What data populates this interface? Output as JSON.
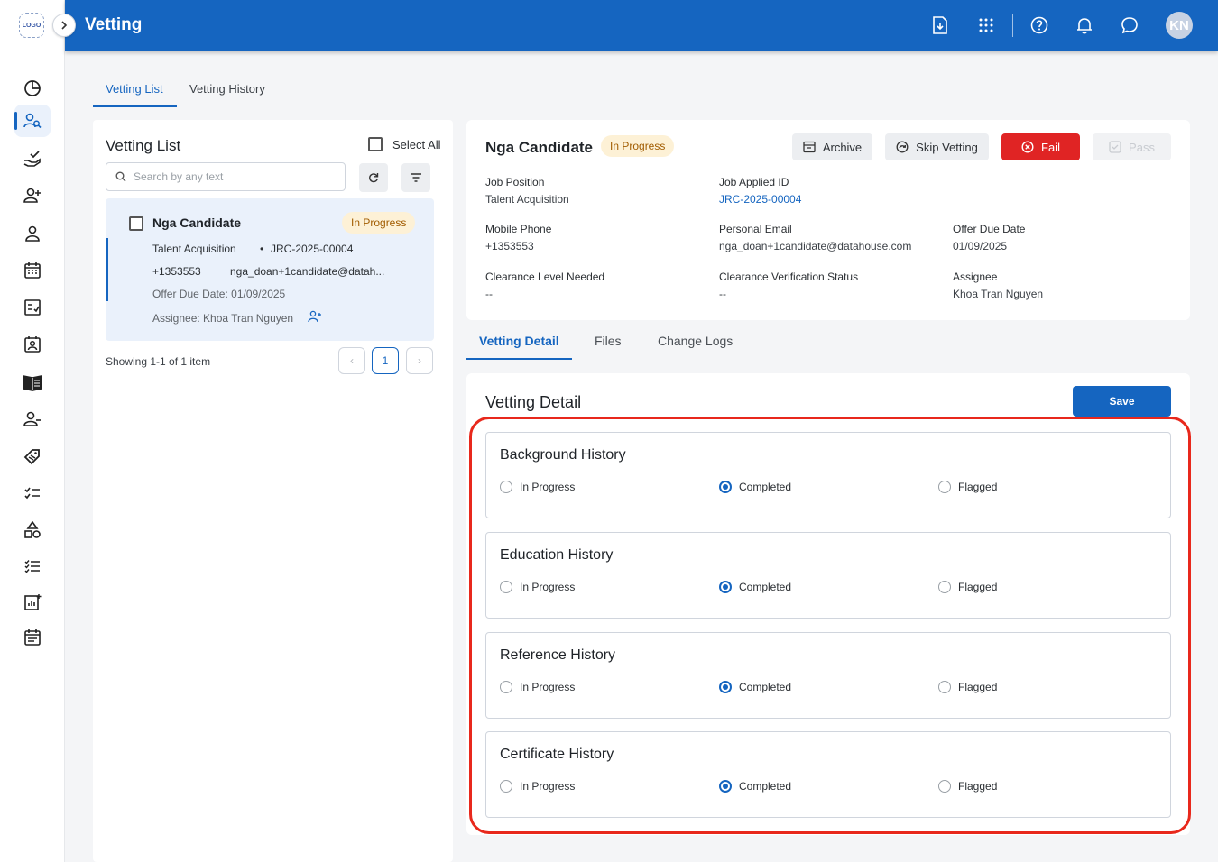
{
  "app": {
    "logo_text": "LOGO",
    "title": "Vetting",
    "avatar_initials": "KN",
    "accent_color": "#1565c0"
  },
  "sidebar": {
    "icons": [
      "dashboard-icon",
      "vetting-icon",
      "hand-check-icon",
      "add-user-icon",
      "user-icon",
      "calendar-icon",
      "checklist-icon",
      "contact-card-icon",
      "book-icon",
      "remove-user-icon",
      "tag-icon",
      "task-list-icon",
      "shapes-icon",
      "list-icon",
      "report-icon",
      "schedule-icon"
    ]
  },
  "header_icons": [
    "download-icon",
    "apps-grid-icon",
    "help-icon",
    "bell-icon",
    "chat-icon"
  ],
  "top_tabs": [
    {
      "label": "Vetting List",
      "active": true
    },
    {
      "label": "Vetting History",
      "active": false
    }
  ],
  "vetting_list": {
    "title": "Vetting List",
    "select_all": "Select All",
    "search_placeholder": "Search by any text",
    "candidate": {
      "name": "Nga Candidate",
      "status": "In Progress",
      "position": "Talent Acquisition",
      "separator": "•",
      "job_id": "JRC-2025-00004",
      "phone": "+1353553",
      "email": "nga_doan+1candidate@datah...",
      "offer_due": "Offer Due Date: 01/09/2025",
      "assignee": "Assignee: Khoa Tran Nguyen"
    },
    "pagination": {
      "summary": "Showing 1-1 of 1 item",
      "prev": "‹",
      "current": "1",
      "next": "›"
    }
  },
  "candidate_header": {
    "name": "Nga Candidate",
    "status": "In Progress",
    "actions": {
      "archive": "Archive",
      "skip": "Skip Vetting",
      "fail": "Fail",
      "pass": "Pass"
    },
    "fields": {
      "job_position_label": "Job Position",
      "job_position": "Talent Acquisition",
      "job_id_label": "Job Applied ID",
      "job_id": "JRC-2025-00004",
      "mobile_label": "Mobile Phone",
      "mobile": "+1353553",
      "email_label": "Personal Email",
      "email": "nga_doan+1candidate@datahouse.com",
      "offer_label": "Offer Due Date",
      "offer": "01/09/2025",
      "clearance_label": "Clearance Level Needed",
      "clearance": "--",
      "verification_label": "Clearance Verification Status",
      "verification": "--",
      "assignee_label": "Assignee",
      "assignee": "Khoa Tran Nguyen"
    }
  },
  "detail_tabs": [
    {
      "label": "Vetting Detail",
      "active": true
    },
    {
      "label": "Files",
      "active": false
    },
    {
      "label": "Change Logs",
      "active": false
    }
  ],
  "vetting_detail": {
    "title": "Vetting Detail",
    "save": "Save",
    "options": [
      "In Progress",
      "Completed",
      "Flagged"
    ],
    "sections": [
      {
        "title": "Background History",
        "selected": "Completed"
      },
      {
        "title": "Education History",
        "selected": "Completed"
      },
      {
        "title": "Reference History",
        "selected": "Completed"
      },
      {
        "title": "Certificate History",
        "selected": "Completed"
      }
    ]
  }
}
